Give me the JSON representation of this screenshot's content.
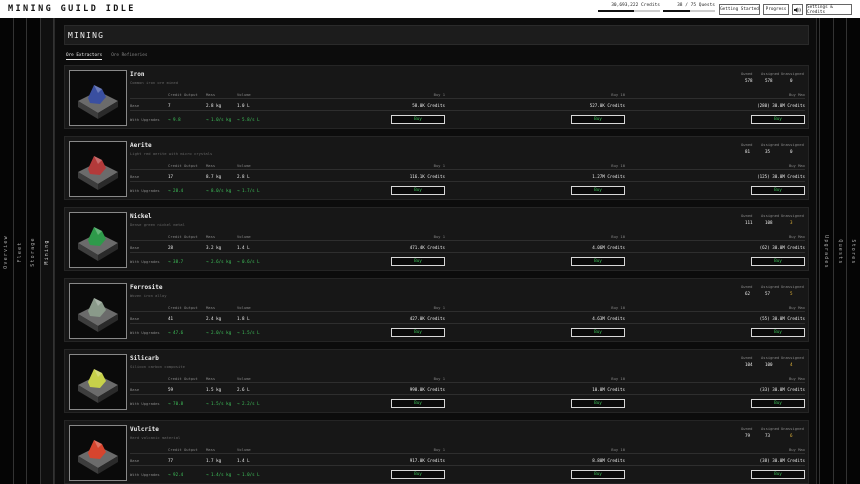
{
  "app": {
    "title": "MINING GUILD IDLE",
    "credits": "30,693,222 Credits",
    "credits_progress": 0.58,
    "quests": "38 / 75 Quests",
    "quests_progress": 0.51,
    "buttons": {
      "getting_started": "Getting Started",
      "progress": "Progress",
      "sound_icon": "speaker-icon",
      "settings": "Settings & Credits"
    }
  },
  "left_nav": [
    "Overview",
    "Fleet",
    "Storage",
    "Mining"
  ],
  "right_nav": [
    "Upgrades",
    "Quests",
    "Stores"
  ],
  "active_nav": "Mining",
  "page": {
    "title": "MINING",
    "tabs": [
      "Ore Extractors",
      "Ore Refineries"
    ],
    "active_tab": "Ore Extractors"
  },
  "labels": {
    "owned": "Owned",
    "assigned": "Assigned",
    "unassigned": "Unassigned",
    "credit_output": "Credit Output",
    "mass": "Mass",
    "volume": "Volume",
    "base": "Base",
    "with_upgrades": "With Upgrades",
    "buy_1": "Buy 1",
    "buy_10": "Buy 10",
    "buy_max": "Buy Max",
    "buy": "Buy"
  },
  "ores": [
    {
      "name": "Iron",
      "desc": "Common iron ore mined",
      "owned": "578",
      "assigned": "578",
      "unassigned": "0",
      "base_output": "7",
      "base_mass": "2.8 kg",
      "base_volume": "1.0 L",
      "up_output": "→ 9.8",
      "up_mass": "→ 1.0/s kg",
      "up_volume": "→ 5.8/s L",
      "buy1": "58.0K Credits",
      "buy10": "527.0K Credits",
      "buymax": "(280) 30.0M Credits",
      "color": "#3a4fa0"
    },
    {
      "name": "Aerite",
      "desc": "Light red aerite with micro crystals",
      "owned": "81",
      "assigned": "35",
      "unassigned": "0",
      "base_output": "17",
      "base_mass": "8.7 kg",
      "base_volume": "2.8 L",
      "up_output": "→ 28.4",
      "up_mass": "→ 8.0/s kg",
      "up_volume": "→ 1.7/s L",
      "buy1": "116.1K Credits",
      "buy10": "1.27M Credits",
      "buymax": "(125) 30.0M Credits",
      "color": "#b33a3a"
    },
    {
      "name": "Nickel",
      "desc": "Dense green nickel metal",
      "owned": "111",
      "assigned": "108",
      "unassigned": "3",
      "base_output": "28",
      "base_mass": "3.2 kg",
      "base_volume": "1.4 L",
      "up_output": "→ 38.7",
      "up_mass": "→ 2.6/s kg",
      "up_volume": "→ 0.6/s L",
      "buy1": "471.4K Credits",
      "buy10": "4.06M Credits",
      "buymax": "(62) 30.0M Credits",
      "color": "#2e9a4a"
    },
    {
      "name": "Ferrosite",
      "desc": "Woven iron alloy",
      "owned": "62",
      "assigned": "57",
      "unassigned": "5",
      "base_output": "41",
      "base_mass": "2.4 kg",
      "base_volume": "1.8 L",
      "up_output": "→ 47.6",
      "up_mass": "→ 2.0/s kg",
      "up_volume": "→ 1.5/s L",
      "buy1": "427.0K Credits",
      "buy10": "4.63M Credits",
      "buymax": "(55) 30.0M Credits",
      "color": "#8a9a8a"
    },
    {
      "name": "Silicarb",
      "desc": "Silicon carbon composite",
      "owned": "104",
      "assigned": "100",
      "unassigned": "4",
      "base_output": "59",
      "base_mass": "1.5 kg",
      "base_volume": "2.6 L",
      "up_output": "→ 70.8",
      "up_mass": "→ 1.5/s kg",
      "up_volume": "→ 2.2/s L",
      "buy1": "998.0K Credits",
      "buy10": "10.0M Credits",
      "buymax": "(33) 30.0M Credits",
      "color": "#c7d14a"
    },
    {
      "name": "Vulcrite",
      "desc": "Hard volcanic material",
      "owned": "79",
      "assigned": "73",
      "unassigned": "6",
      "base_output": "77",
      "base_mass": "1.7 kg",
      "base_volume": "1.4 L",
      "up_output": "→ 92.4",
      "up_mass": "→ 1.4/s kg",
      "up_volume": "→ 1.0/s L",
      "buy1": "917.0K Credits",
      "buy10": "8.80M Credits",
      "buymax": "(38) 30.0M Credits",
      "color": "#d6452e"
    }
  ]
}
